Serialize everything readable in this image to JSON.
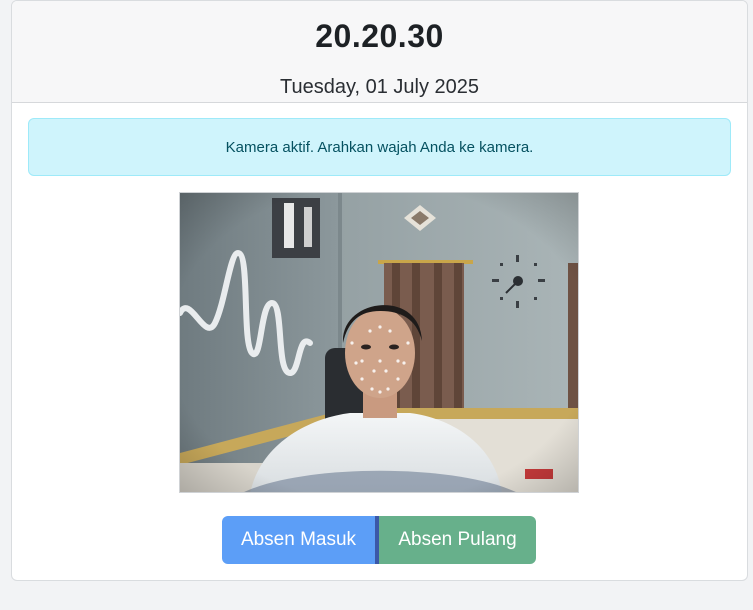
{
  "clock": {
    "time": "20.20.30",
    "date": "Tuesday, 01 July 2025"
  },
  "alert": {
    "message": "Kamera aktif. Arahkan wajah Anda ke kamera."
  },
  "camera": {
    "feed": "live-webcam-face-detection"
  },
  "actions": {
    "check_in_label": "Absen Masuk",
    "check_out_label": "Absen Pulang"
  },
  "colors": {
    "alert_bg": "#cff4fc",
    "alert_text": "#055160",
    "check_in_bg": "#5c9ef7",
    "check_out_bg": "#67b08b"
  }
}
